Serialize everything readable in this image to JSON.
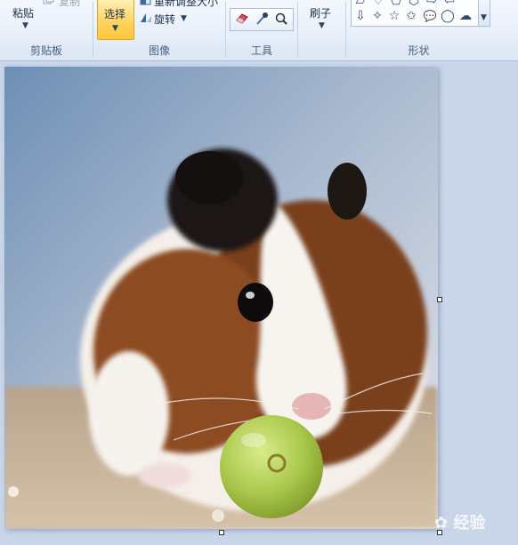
{
  "ribbon": {
    "clipboard": {
      "paste_label": "粘贴",
      "copy_label": "复制",
      "group_label": "剪贴板"
    },
    "image": {
      "select_label": "选择",
      "resize_label": "重新调整大小",
      "rotate_label": "旋转",
      "group_label": "图像"
    },
    "tools": {
      "group_label": "工具",
      "icons": [
        "eraser-icon",
        "color-picker-icon",
        "magnifier-icon"
      ]
    },
    "brushes": {
      "label": "刷子"
    },
    "shapes": {
      "group_label": "形状",
      "row1": [
        "▱",
        "♢",
        "⬠",
        "⬡",
        "⇨",
        "⇦"
      ],
      "row2": [
        "⇩",
        "✧",
        "☆",
        "✩",
        "💬",
        "◯",
        "☁"
      ]
    }
  },
  "canvas": {
    "watermark": "经验"
  },
  "colors": {
    "accent": "#ffc63a",
    "ribbon_bg": "#e3ecf8",
    "workspace": "#c9d6e9"
  }
}
